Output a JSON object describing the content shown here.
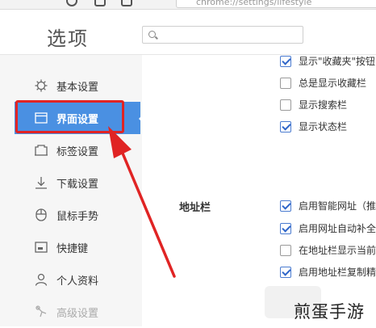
{
  "browser": {
    "address_text": "chrome://settings/lifestyle"
  },
  "page": {
    "title": "选项"
  },
  "search": {
    "placeholder": ""
  },
  "sidebar": {
    "items": [
      {
        "label": "基本设置",
        "icon": "gear-icon"
      },
      {
        "label": "界面设置",
        "icon": "window-icon",
        "active": true
      },
      {
        "label": "标签设置",
        "icon": "tab-icon"
      },
      {
        "label": "下载设置",
        "icon": "download-icon"
      },
      {
        "label": "鼠标手势",
        "icon": "mouse-icon"
      },
      {
        "label": "快捷键",
        "icon": "keyboard-icon"
      },
      {
        "label": "个人资料",
        "icon": "person-icon"
      },
      {
        "label": "高级设置",
        "icon": "advanced-icon"
      }
    ]
  },
  "main": {
    "interface_options": [
      {
        "label": "显示\"收藏夹\"按钮",
        "checked": true
      },
      {
        "label": "总是显示收藏栏",
        "checked": false
      },
      {
        "label": "显示搜索栏",
        "checked": false
      },
      {
        "label": "显示状态栏",
        "checked": true
      }
    ],
    "address_bar": {
      "section_label": "地址栏",
      "options": [
        {
          "label": "启用智能网址（推",
          "checked": true
        },
        {
          "label": "启用网址自动补全",
          "checked": true
        },
        {
          "label": "在地址栏显示当前",
          "checked": false
        },
        {
          "label": "启用地址栏复制精",
          "checked": true
        }
      ]
    }
  },
  "watermark": {
    "text": "煎蛋手游"
  },
  "colors": {
    "accent": "#4a90e2",
    "highlight_red": "#e02424",
    "sidebar_bg": "#f6f6f6"
  }
}
